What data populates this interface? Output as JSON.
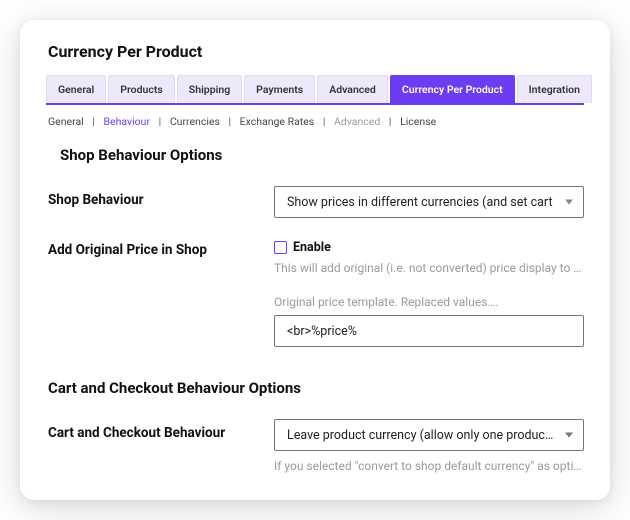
{
  "page_title": "Currency Per Product",
  "main_tabs": [
    "General",
    "Products",
    "Shipping",
    "Payments",
    "Advanced",
    "Currency Per Product",
    "Integration"
  ],
  "main_tab_active_index": 5,
  "subnav": [
    {
      "label": "General",
      "style": "normal"
    },
    {
      "label": "Behaviour",
      "style": "active"
    },
    {
      "label": "Currencies",
      "style": "normal"
    },
    {
      "label": "Exchange Rates",
      "style": "normal"
    },
    {
      "label": "Advanced",
      "style": "muted"
    },
    {
      "label": "License",
      "style": "normal"
    }
  ],
  "section1": {
    "heading": "Shop Behaviour Options",
    "shop_behaviour": {
      "label": "Shop Behaviour",
      "value": "Show prices in different currencies (and set cart"
    },
    "add_original": {
      "label": "Add Original Price in Shop",
      "checkbox_label": "Enable",
      "checked": false,
      "description": "This will add original (i.e. not converted) price display to …",
      "template_label": "Original price template. Replaced values….",
      "template_value": "<br>%price%"
    }
  },
  "section2": {
    "heading": "Cart and Checkout Behaviour Options",
    "cart_behaviour": {
      "label": "Cart and Checkout Behaviour",
      "value": "Leave product currency (allow only one product…",
      "note": "If you selected \"convert to shop default currency\" as option…"
    }
  },
  "colors": {
    "accent": "#6b3cf2"
  }
}
